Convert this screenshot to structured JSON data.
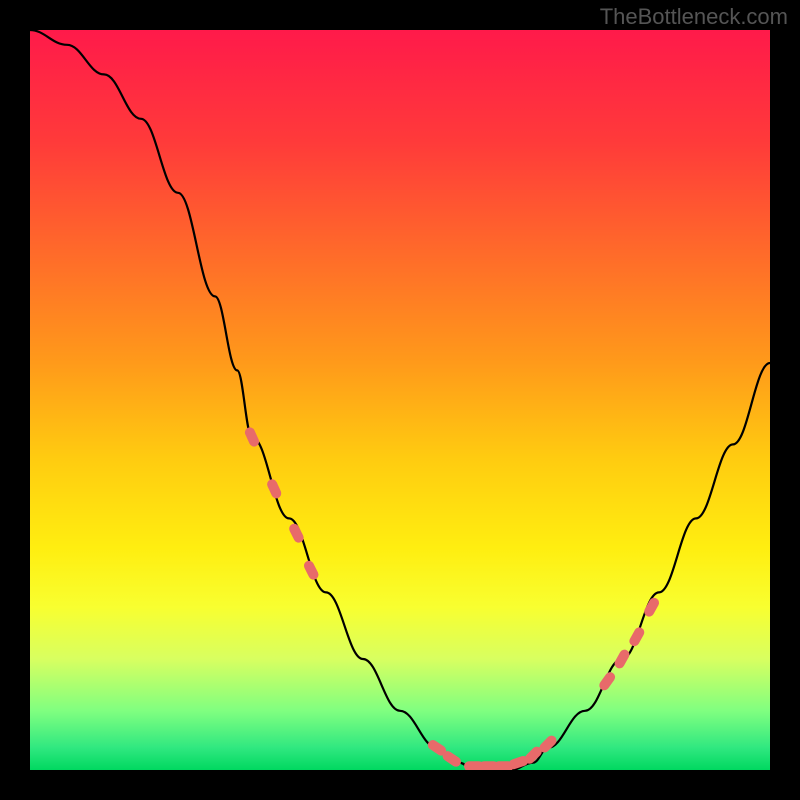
{
  "watermark": "TheBottleneck.com",
  "chart_data": {
    "type": "line",
    "title": "",
    "xlabel": "",
    "ylabel": "",
    "xlim": [
      0,
      100
    ],
    "ylim": [
      0,
      100
    ],
    "series": [
      {
        "name": "curve",
        "x": [
          0,
          5,
          10,
          15,
          20,
          25,
          28,
          30,
          35,
          40,
          45,
          50,
          55,
          58,
          60,
          63,
          65,
          68,
          70,
          75,
          80,
          85,
          90,
          95,
          100
        ],
        "y": [
          100,
          98,
          94,
          88,
          78,
          64,
          54,
          45,
          34,
          24,
          15,
          8,
          3,
          1,
          0,
          0,
          0,
          1,
          3,
          8,
          15,
          24,
          34,
          44,
          55
        ]
      }
    ],
    "markers": [
      {
        "x": 30,
        "y": 45
      },
      {
        "x": 33,
        "y": 38
      },
      {
        "x": 36,
        "y": 32
      },
      {
        "x": 38,
        "y": 27
      },
      {
        "x": 55,
        "y": 3
      },
      {
        "x": 57,
        "y": 1.5
      },
      {
        "x": 60,
        "y": 0.5
      },
      {
        "x": 62,
        "y": 0.5
      },
      {
        "x": 64,
        "y": 0.5
      },
      {
        "x": 66,
        "y": 1
      },
      {
        "x": 68,
        "y": 2
      },
      {
        "x": 70,
        "y": 3.5
      },
      {
        "x": 78,
        "y": 12
      },
      {
        "x": 80,
        "y": 15
      },
      {
        "x": 82,
        "y": 18
      },
      {
        "x": 84,
        "y": 22
      }
    ],
    "gradient_stops": [
      {
        "offset": 0,
        "color": "#ff1a4a"
      },
      {
        "offset": 15,
        "color": "#ff3a3a"
      },
      {
        "offset": 30,
        "color": "#ff6a2a"
      },
      {
        "offset": 45,
        "color": "#ff9a1a"
      },
      {
        "offset": 58,
        "color": "#ffcc10"
      },
      {
        "offset": 70,
        "color": "#ffee10"
      },
      {
        "offset": 78,
        "color": "#f8ff30"
      },
      {
        "offset": 85,
        "color": "#d8ff60"
      },
      {
        "offset": 92,
        "color": "#80ff80"
      },
      {
        "offset": 97,
        "color": "#30e880"
      },
      {
        "offset": 100,
        "color": "#00d860"
      }
    ],
    "marker_color": "#e86a6a",
    "curve_color": "#000000"
  }
}
